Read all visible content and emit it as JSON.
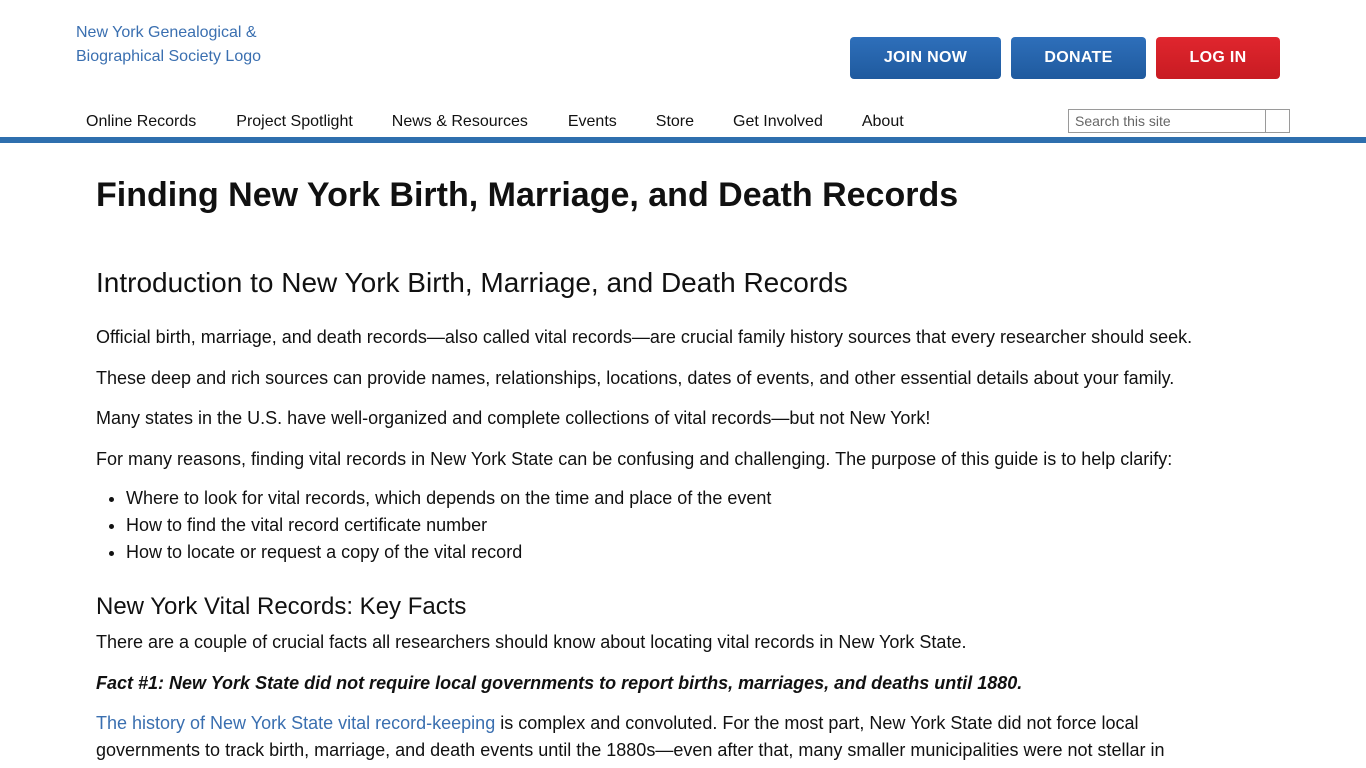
{
  "header": {
    "logo_alt": "New York Genealogical & Biographical Society Logo",
    "buttons": {
      "join": "JOIN NOW",
      "donate": "DONATE",
      "login": "LOG IN"
    },
    "colors": {
      "primary": "#1f5a9e",
      "danger": "#c81b22",
      "rule": "#2e6fae"
    }
  },
  "nav": {
    "items": [
      {
        "label": "Online Records"
      },
      {
        "label": "Project Spotlight"
      },
      {
        "label": "News & Resources"
      },
      {
        "label": "Events"
      },
      {
        "label": "Store"
      },
      {
        "label": "Get Involved"
      },
      {
        "label": "About"
      }
    ]
  },
  "search": {
    "placeholder": "Search this site"
  },
  "article": {
    "title": "Finding New York Birth, Marriage, and Death Records",
    "intro_heading": "Introduction to New York Birth, Marriage, and Death Records",
    "paragraphs": [
      "Official birth, marriage, and death records—also called vital records—are crucial family history sources that every researcher should seek.",
      "These deep and rich sources can provide names, relationships, locations, dates of events, and other essential details about your family.",
      "Many states in the U.S. have well-organized and complete collections of vital records—but not New York!",
      "For many reasons, finding vital records in New York State can be confusing and challenging. The purpose of this guide is to help clarify:"
    ],
    "bullets": [
      "Where to look for vital records, which depends on the time and place of the event",
      "How to find the vital record certificate number",
      "How to locate or request a copy of the vital record"
    ],
    "facts_heading": "New York Vital Records: Key Facts",
    "facts_intro": "There are a couple of crucial facts all researchers should know about locating vital records in New York State.",
    "fact1": "Fact #1: New York State did not require local governments to report births, marriages, and deaths until 1880.",
    "history_link": "The history of New York State vital record-keeping",
    "history_text_1": " is complex and convoluted. For the most part, New York State did not force local",
    "history_text_2": "governments to track birth, marriage, and death events until the 1880s—even after that, many smaller municipalities were not stellar in"
  }
}
